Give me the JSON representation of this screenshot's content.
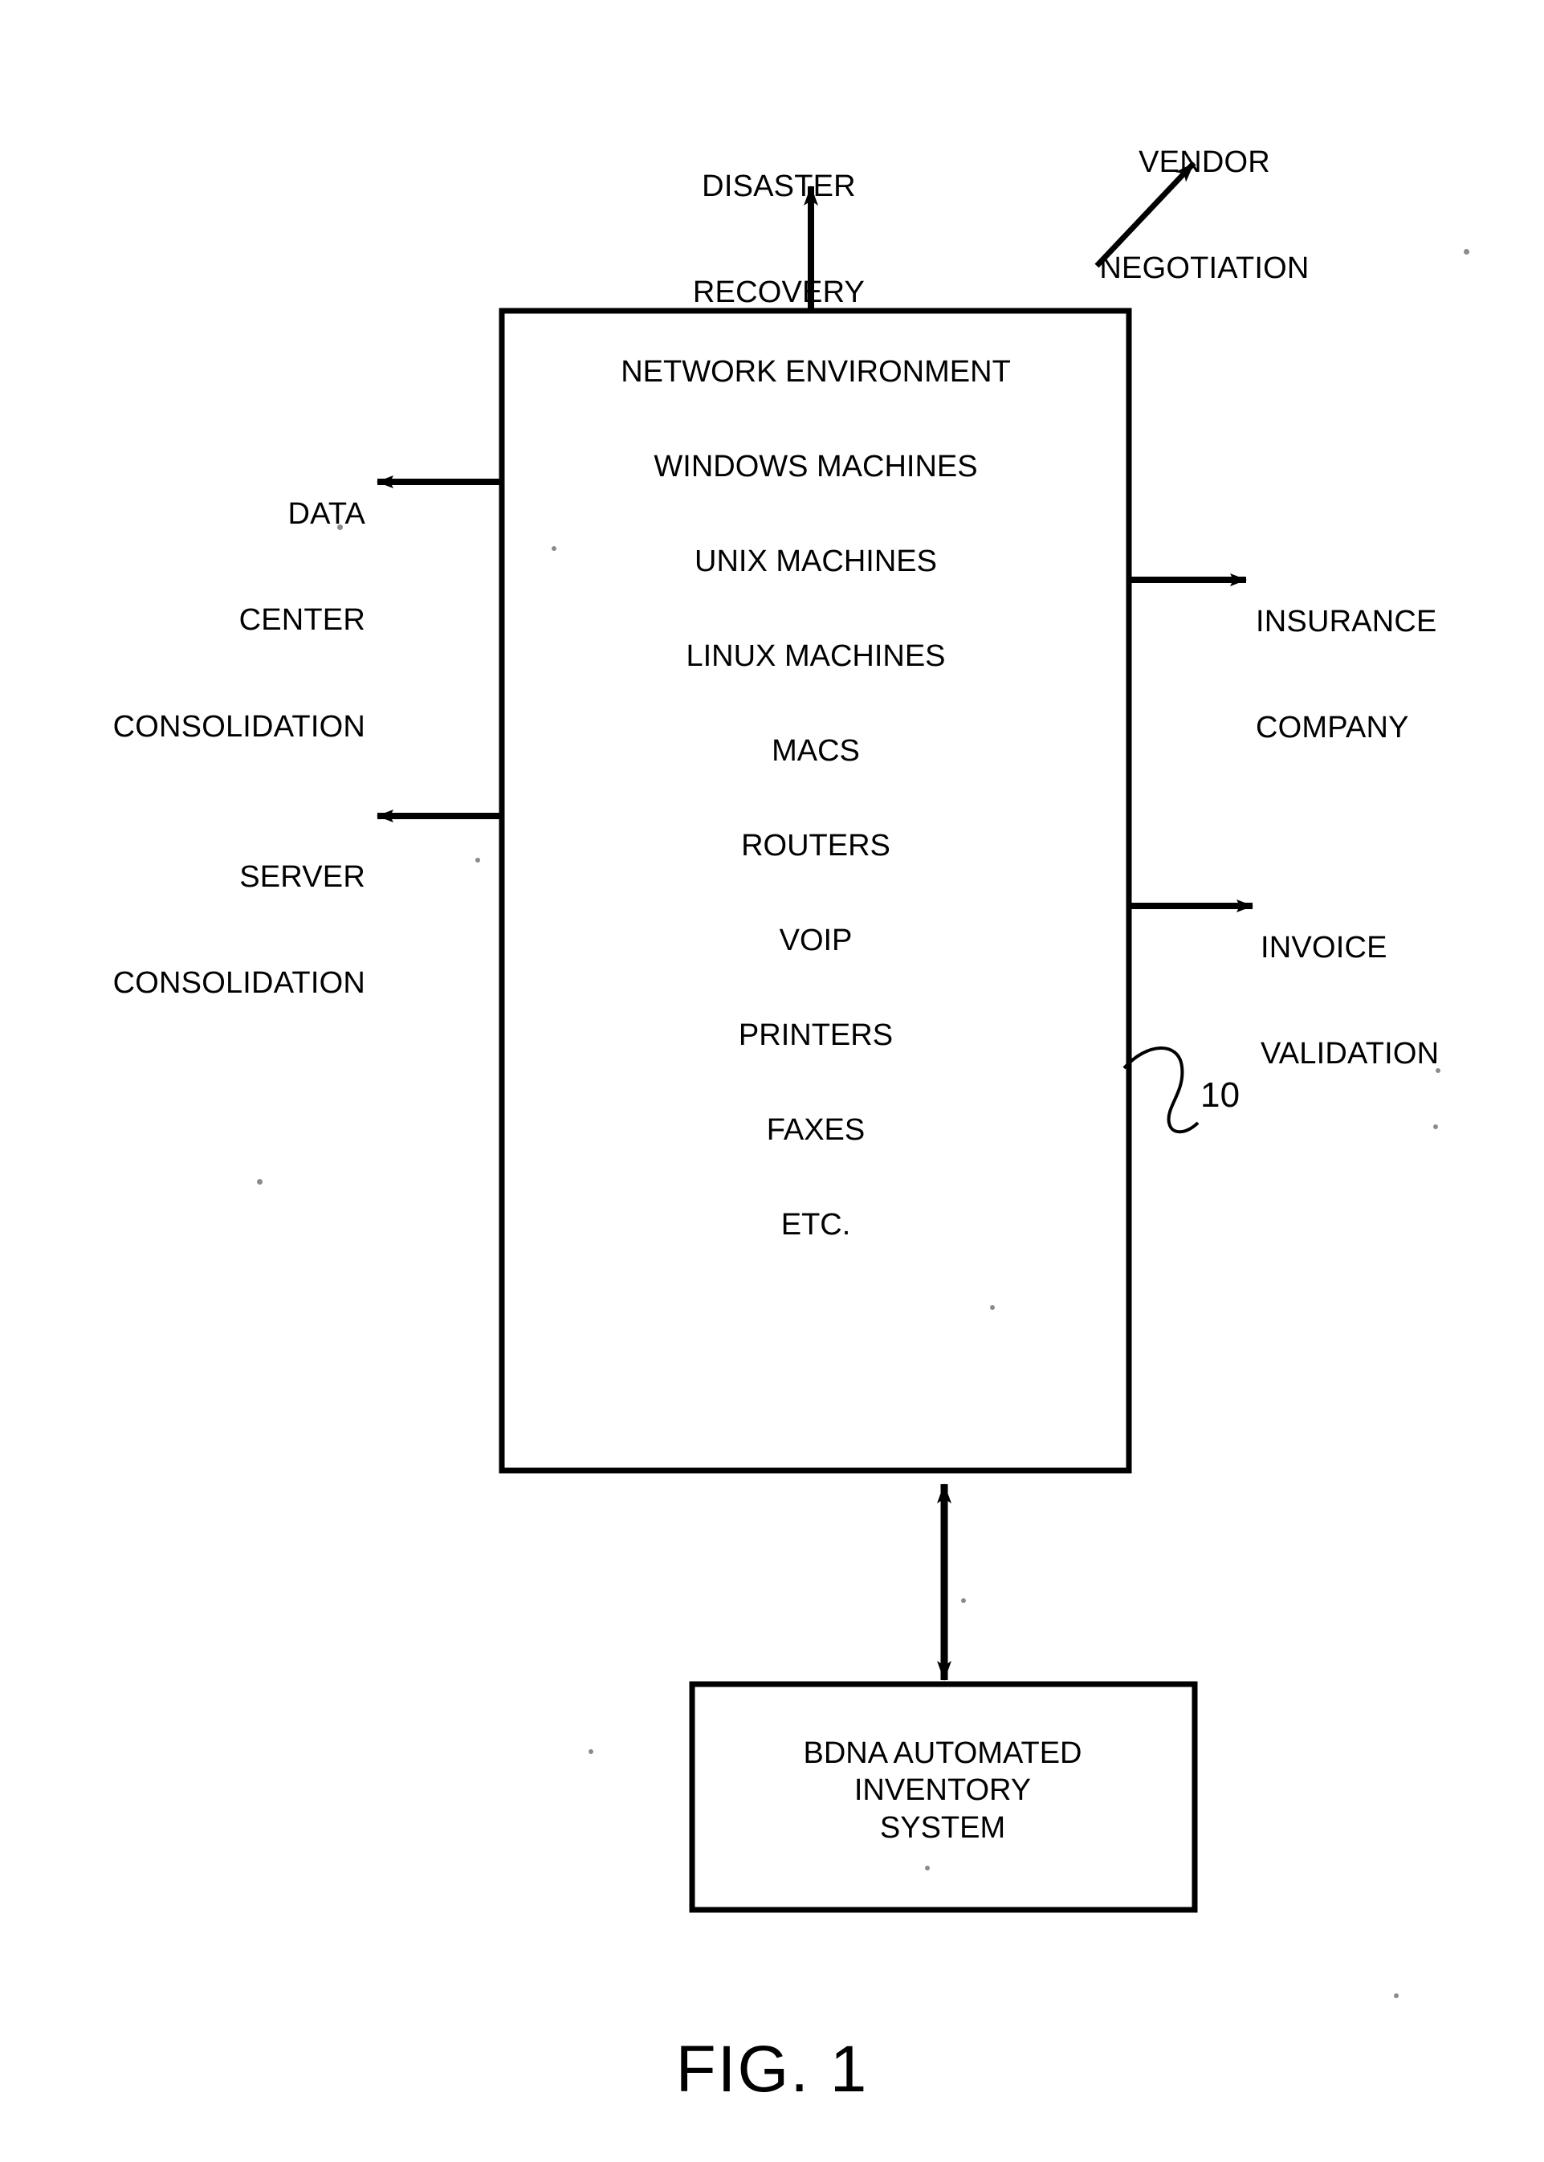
{
  "figure": {
    "caption": "FIG. 1",
    "reference_numeral": "10"
  },
  "main_box": {
    "name": "network-environment",
    "items": [
      "NETWORK ENVIRONMENT",
      "WINDOWS MACHINES",
      "UNIX MACHINES",
      "LINUX MACHINES",
      "MACS",
      "ROUTERS",
      "VOIP",
      "PRINTERS",
      "FAXES",
      "ETC."
    ]
  },
  "bottom_box": {
    "name": "bdna-automated-inventory-system",
    "lines": [
      "BDNA AUTOMATED",
      "INVENTORY",
      "SYSTEM"
    ]
  },
  "external_labels": {
    "disaster_recovery": {
      "lines": [
        "DISASTER",
        "RECOVERY"
      ],
      "direction": "up"
    },
    "vendor_negotiation": {
      "lines": [
        "VENDOR",
        "NEGOTIATION"
      ],
      "direction": "up-right"
    },
    "data_center_consolidation": {
      "lines": [
        "DATA",
        "CENTER",
        "CONSOLIDATION"
      ],
      "direction": "left"
    },
    "server_consolidation": {
      "lines": [
        "SERVER",
        "CONSOLIDATION"
      ],
      "direction": "left"
    },
    "insurance_company": {
      "lines": [
        "INSURANCE",
        "COMPANY"
      ],
      "direction": "right"
    },
    "invoice_validation": {
      "lines": [
        "INVOICE",
        "VALIDATION"
      ],
      "direction": "right"
    }
  },
  "colors": {
    "ink": "#000000",
    "paper": "#ffffff"
  }
}
